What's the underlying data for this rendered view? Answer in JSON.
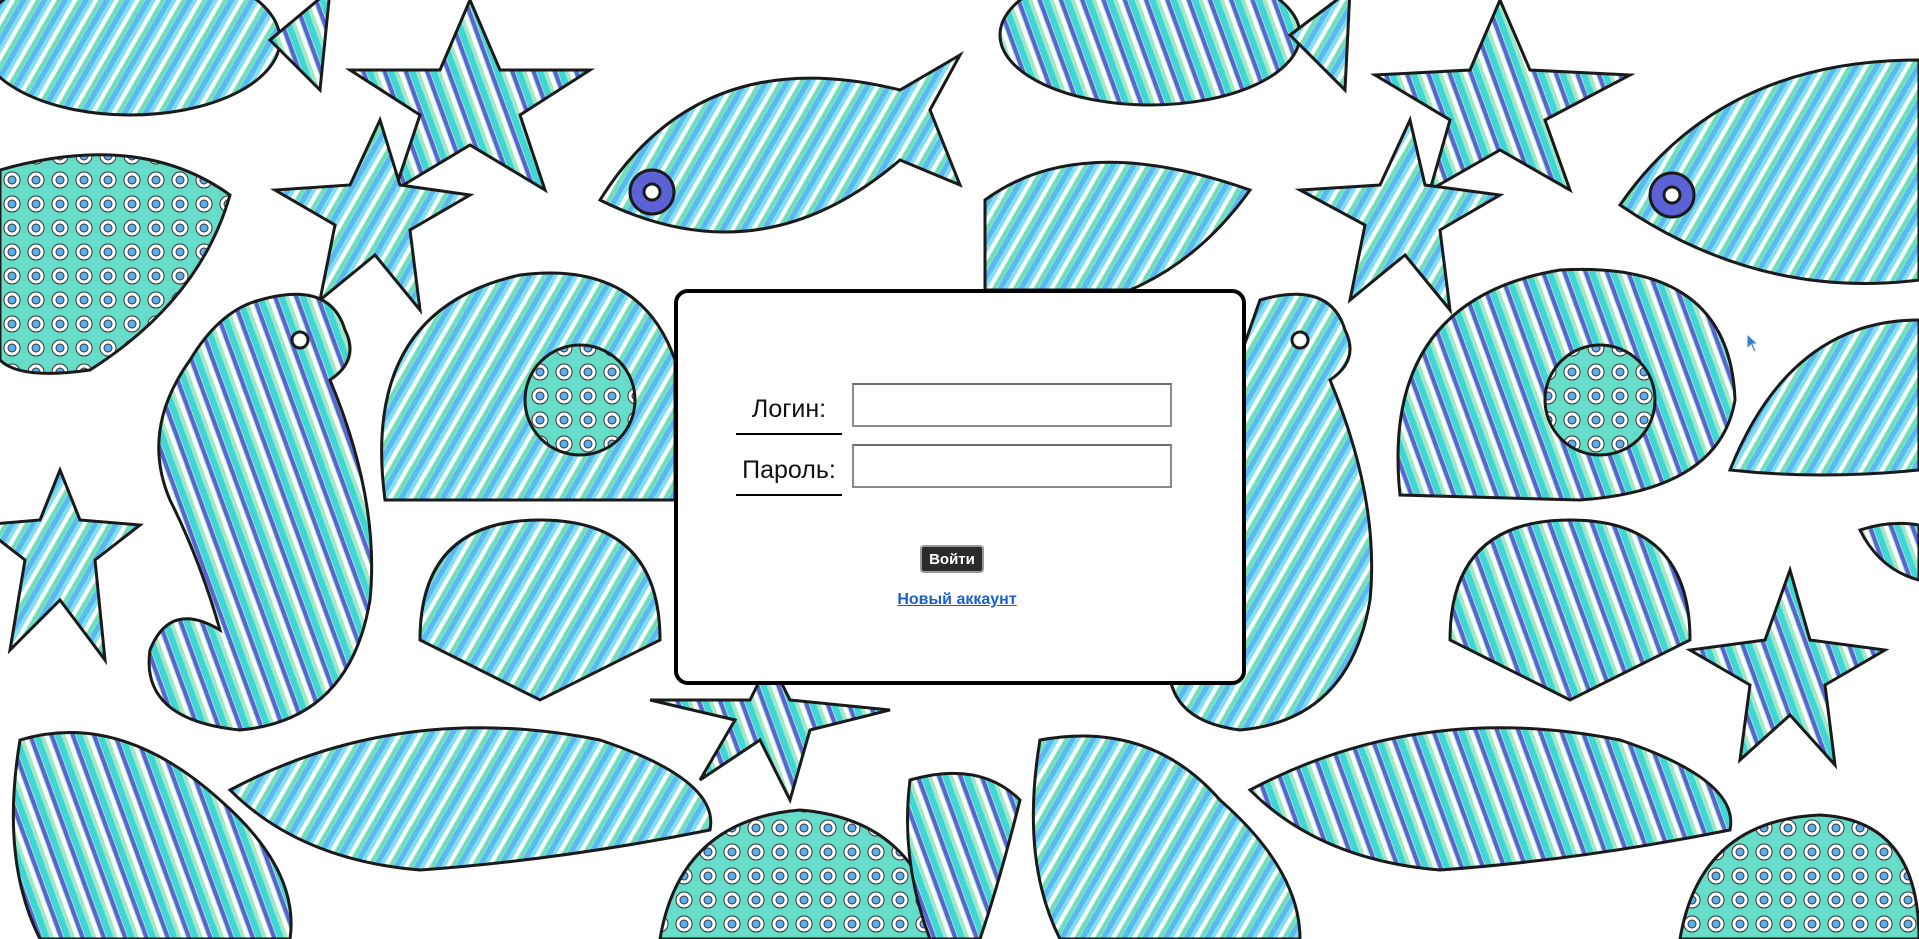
{
  "login_form": {
    "login_label": "Логин:",
    "login_value": "",
    "password_label": "Пароль:",
    "password_value": "",
    "submit_label": "Войти",
    "new_account_link": "Новый аккаунт"
  },
  "background": {
    "pattern": "zentangle-sea-creatures",
    "motifs": [
      "fish-icon",
      "starfish-icon",
      "seashell-icon",
      "seahorse-icon",
      "scallop-shell-icon",
      "conch-shell-icon"
    ],
    "colors": [
      "#6fd5f0",
      "#3fe0d8",
      "#5bb8f5",
      "#5560d8",
      "#70e0a0",
      "#9fe8c8",
      "#7a9a96",
      "#ffffff"
    ]
  },
  "cursor_icon": "mouse-pointer-icon"
}
